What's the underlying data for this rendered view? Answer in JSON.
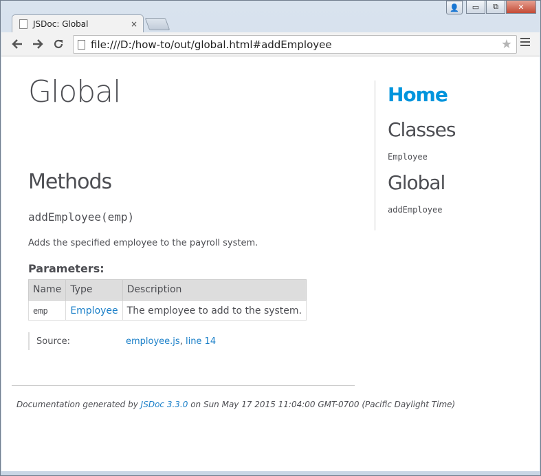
{
  "browser": {
    "tab_title": "JSDoc: Global",
    "tab_close": "×",
    "url": "file:///D:/how-to/out/global.html#addEmployee",
    "caption": {
      "user": "👤",
      "minimize": "▭",
      "restore": "⧉",
      "close": "✕"
    },
    "icons": {
      "back": "back-arrow-icon",
      "forward": "forward-arrow-icon",
      "reload": "reload-icon",
      "star": "star-icon",
      "menu": "hamburger-menu-icon"
    }
  },
  "page": {
    "title": "Global",
    "methods_heading": "Methods",
    "method_signature": "addEmployee(emp)",
    "method_description": "Adds the specified employee to the payroll system.",
    "parameters_heading": "Parameters:",
    "params_table": {
      "headers": [
        "Name",
        "Type",
        "Description"
      ],
      "rows": [
        {
          "name": "emp",
          "type": "Employee",
          "description": "The employee to add to the system."
        }
      ]
    },
    "source_label": "Source:",
    "source_file": "employee.js",
    "source_sep": ",",
    "source_line": "line 14",
    "footer_prefix": "Documentation generated by",
    "footer_link": "JSDoc 3.3.0",
    "footer_suffix": "on Sun May 17 2015 11:04:00 GMT-0700 (Pacific Daylight Time)"
  },
  "sidebar": {
    "home": "Home",
    "classes_heading": "Classes",
    "classes": [
      "Employee"
    ],
    "global_heading": "Global",
    "globals": [
      "addEmployee"
    ]
  },
  "colors": {
    "link": "#1a7fc8",
    "home_link": "#0095dd",
    "text": "#4d4e53"
  }
}
